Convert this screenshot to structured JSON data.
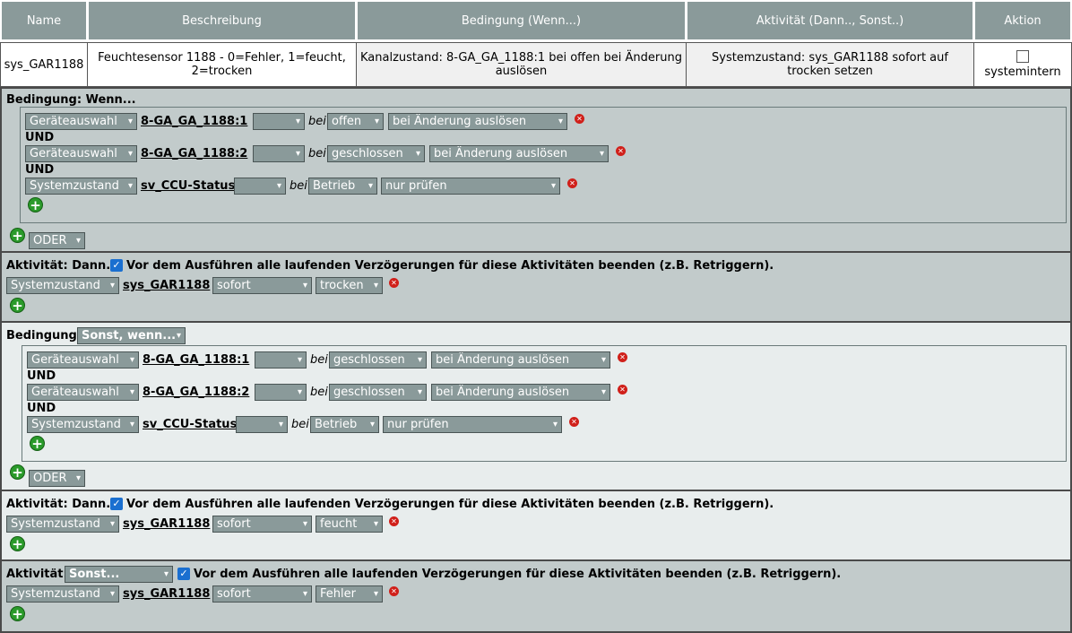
{
  "header": {
    "name": "Name",
    "beschreibung": "Beschreibung",
    "bedingung": "Bedingung (Wenn...)",
    "aktivitaet": "Aktivität (Dann.., Sonst..)",
    "aktion": "Aktion"
  },
  "row": {
    "name": "sys_GAR1188",
    "beschreibung": "Feuchtesensor 1188 - 0=Fehler, 1=feucht, 2=trocken",
    "bedingung": "Kanalzustand: 8-GA_GA_1188:1 bei offen bei Änderung auslösen",
    "aktivitaet": "Systemzustand: sys_GAR1188 sofort auf trocken setzen",
    "aktion_label": "systemintern"
  },
  "cond1": {
    "label": "Bedingung: Wenn...",
    "und": "UND",
    "bei": "bei",
    "lines": [
      {
        "type": "Geräteauswahl",
        "target": "8-GA_GA_1188:1",
        "state": "offen",
        "trigger": "bei Änderung auslösen"
      },
      {
        "type": "Geräteauswahl",
        "target": "8-GA_GA_1188:2",
        "state": "geschlossen",
        "trigger": "bei Änderung auslösen"
      },
      {
        "type": "Systemzustand",
        "target": "sv_CCU-Status",
        "state": "Betrieb",
        "trigger": "nur prüfen"
      }
    ],
    "oder": "ODER"
  },
  "act1": {
    "label": "Aktivität: Dann...",
    "checkbox_text": "Vor dem Ausführen alle laufenden Verzögerungen für diese Aktivitäten beenden (z.B. Retriggern).",
    "type": "Systemzustand",
    "target": "sys_GAR1188",
    "timing": "sofort",
    "value": "trocken"
  },
  "cond2": {
    "label": "Bedingung:",
    "mode": "Sonst, wenn...",
    "und": "UND",
    "bei": "bei",
    "lines": [
      {
        "type": "Geräteauswahl",
        "target": "8-GA_GA_1188:1",
        "state": "geschlossen",
        "trigger": "bei Änderung auslösen"
      },
      {
        "type": "Geräteauswahl",
        "target": "8-GA_GA_1188:2",
        "state": "geschlossen",
        "trigger": "bei Änderung auslösen"
      },
      {
        "type": "Systemzustand",
        "target": "sv_CCU-Status",
        "state": "Betrieb",
        "trigger": "nur prüfen"
      }
    ],
    "oder": "ODER"
  },
  "act2": {
    "label": "Aktivität: Dann...",
    "checkbox_text": "Vor dem Ausführen alle laufenden Verzögerungen für diese Aktivitäten beenden (z.B. Retriggern).",
    "type": "Systemzustand",
    "target": "sys_GAR1188",
    "timing": "sofort",
    "value": "feucht"
  },
  "act3": {
    "label": "Aktivität:",
    "mode": "Sonst...",
    "checkbox_text": "Vor dem Ausführen alle laufenden Verzögerungen für diese Aktivitäten beenden (z.B. Retriggern).",
    "type": "Systemzustand",
    "target": "sys_GAR1188",
    "timing": "sofort",
    "value": "Fehler"
  },
  "colors": {
    "header_bg": "#8a9a9a",
    "section_gray": "#c2cbcb",
    "section_light": "#e8eded",
    "select_bg": "#8a9a9a",
    "delete": "#d0201a",
    "add": "#2a9a2a",
    "checkbox": "#1a6fd0"
  }
}
